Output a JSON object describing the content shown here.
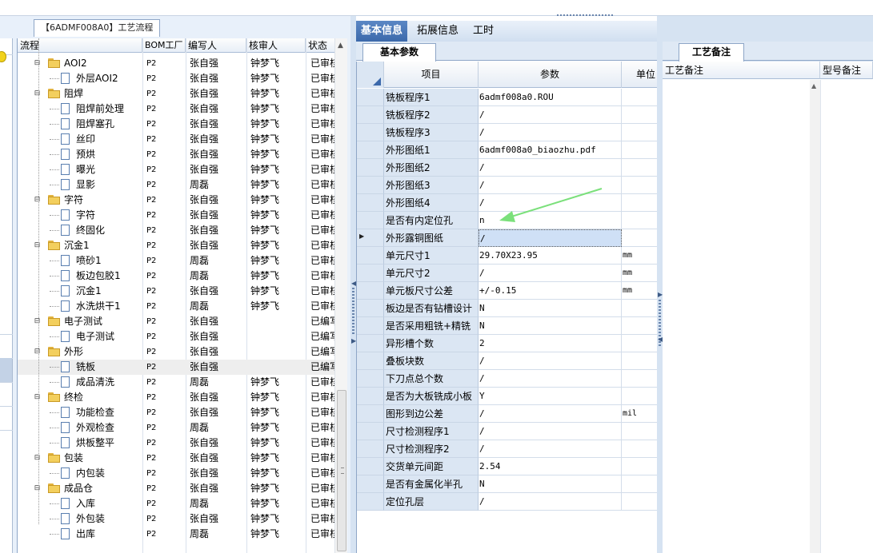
{
  "left": {
    "tab_title": "【6ADMF008A0】工艺流程",
    "columns": [
      "流程",
      "BOM工厂",
      "编写人",
      "核审人",
      "状态"
    ],
    "rows": [
      {
        "name": "AOI2",
        "level": 1,
        "type": "folder",
        "factory": "P2",
        "writer": "张自强",
        "reviewer": "钟梦飞",
        "status": "已审核"
      },
      {
        "name": "外层AOI2",
        "level": 2,
        "type": "doc",
        "factory": "P2",
        "writer": "张自强",
        "reviewer": "钟梦飞",
        "status": "已审核"
      },
      {
        "name": "阻焊",
        "level": 1,
        "type": "folder",
        "factory": "P2",
        "writer": "张自强",
        "reviewer": "钟梦飞",
        "status": "已审核"
      },
      {
        "name": "阻焊前处理",
        "level": 2,
        "type": "doc",
        "factory": "P2",
        "writer": "张自强",
        "reviewer": "钟梦飞",
        "status": "已审核"
      },
      {
        "name": "阻焊塞孔",
        "level": 2,
        "type": "doc",
        "factory": "P2",
        "writer": "张自强",
        "reviewer": "钟梦飞",
        "status": "已审核"
      },
      {
        "name": "丝印",
        "level": 2,
        "type": "doc",
        "factory": "P2",
        "writer": "张自强",
        "reviewer": "钟梦飞",
        "status": "已审核"
      },
      {
        "name": "预烘",
        "level": 2,
        "type": "doc",
        "factory": "P2",
        "writer": "张自强",
        "reviewer": "钟梦飞",
        "status": "已审核"
      },
      {
        "name": "曝光",
        "level": 2,
        "type": "doc",
        "factory": "P2",
        "writer": "张自强",
        "reviewer": "钟梦飞",
        "status": "已审核"
      },
      {
        "name": "显影",
        "level": 2,
        "type": "doc",
        "factory": "P2",
        "writer": "周磊",
        "reviewer": "钟梦飞",
        "status": "已审核"
      },
      {
        "name": "字符",
        "level": 1,
        "type": "folder",
        "factory": "P2",
        "writer": "张自强",
        "reviewer": "钟梦飞",
        "status": "已审核"
      },
      {
        "name": "字符",
        "level": 2,
        "type": "doc",
        "factory": "P2",
        "writer": "张自强",
        "reviewer": "钟梦飞",
        "status": "已审核"
      },
      {
        "name": "终固化",
        "level": 2,
        "type": "doc",
        "factory": "P2",
        "writer": "张自强",
        "reviewer": "钟梦飞",
        "status": "已审核"
      },
      {
        "name": "沉金1",
        "level": 1,
        "type": "folder",
        "factory": "P2",
        "writer": "张自强",
        "reviewer": "钟梦飞",
        "status": "已审核"
      },
      {
        "name": "喷砂1",
        "level": 2,
        "type": "doc",
        "factory": "P2",
        "writer": "周磊",
        "reviewer": "钟梦飞",
        "status": "已审核"
      },
      {
        "name": "板边包胶1",
        "level": 2,
        "type": "doc",
        "factory": "P2",
        "writer": "周磊",
        "reviewer": "钟梦飞",
        "status": "已审核"
      },
      {
        "name": "沉金1",
        "level": 2,
        "type": "doc",
        "factory": "P2",
        "writer": "张自强",
        "reviewer": "钟梦飞",
        "status": "已审核"
      },
      {
        "name": "水洗烘干1",
        "level": 2,
        "type": "doc",
        "factory": "P2",
        "writer": "周磊",
        "reviewer": "钟梦飞",
        "status": "已审核"
      },
      {
        "name": "电子测试",
        "level": 1,
        "type": "folder",
        "factory": "P2",
        "writer": "张自强",
        "reviewer": "",
        "status": "已编写"
      },
      {
        "name": "电子测试",
        "level": 2,
        "type": "doc",
        "factory": "P2",
        "writer": "张自强",
        "reviewer": "",
        "status": "已编写"
      },
      {
        "name": "外形",
        "level": 1,
        "type": "folder",
        "factory": "P2",
        "writer": "张自强",
        "reviewer": "",
        "status": "已编写"
      },
      {
        "name": "铣板",
        "level": 2,
        "type": "doc",
        "factory": "P2",
        "writer": "张自强",
        "reviewer": "",
        "status": "已编写",
        "selected": true
      },
      {
        "name": "成品清洗",
        "level": 2,
        "type": "doc",
        "factory": "P2",
        "writer": "周磊",
        "reviewer": "钟梦飞",
        "status": "已审核"
      },
      {
        "name": "终检",
        "level": 1,
        "type": "folder",
        "factory": "P2",
        "writer": "张自强",
        "reviewer": "钟梦飞",
        "status": "已审核"
      },
      {
        "name": "功能检查",
        "level": 2,
        "type": "doc",
        "factory": "P2",
        "writer": "张自强",
        "reviewer": "钟梦飞",
        "status": "已审核"
      },
      {
        "name": "外观检查",
        "level": 2,
        "type": "doc",
        "factory": "P2",
        "writer": "周磊",
        "reviewer": "钟梦飞",
        "status": "已审核"
      },
      {
        "name": "烘板整平",
        "level": 2,
        "type": "doc",
        "factory": "P2",
        "writer": "张自强",
        "reviewer": "钟梦飞",
        "status": "已审核"
      },
      {
        "name": "包装",
        "level": 1,
        "type": "folder",
        "factory": "P2",
        "writer": "张自强",
        "reviewer": "钟梦飞",
        "status": "已审核"
      },
      {
        "name": "内包装",
        "level": 2,
        "type": "doc",
        "factory": "P2",
        "writer": "张自强",
        "reviewer": "钟梦飞",
        "status": "已审核"
      },
      {
        "name": "成品仓",
        "level": 1,
        "type": "folder",
        "factory": "P2",
        "writer": "张自强",
        "reviewer": "钟梦飞",
        "status": "已审核"
      },
      {
        "name": "入库",
        "level": 2,
        "type": "doc",
        "factory": "P2",
        "writer": "周磊",
        "reviewer": "钟梦飞",
        "status": "已审核"
      },
      {
        "name": "外包装",
        "level": 2,
        "type": "doc",
        "factory": "P2",
        "writer": "张自强",
        "reviewer": "钟梦飞",
        "status": "已审核"
      },
      {
        "name": "出库",
        "level": 2,
        "type": "doc",
        "factory": "P2",
        "writer": "周磊",
        "reviewer": "钟梦飞",
        "status": "已审核"
      }
    ]
  },
  "middle": {
    "tabs": [
      "基本信息",
      "拓展信息",
      "工时"
    ],
    "active_tab": "基本信息",
    "subtab": "基本参数",
    "columns": [
      "项目",
      "参数",
      "单位"
    ],
    "rows": [
      {
        "item": "铣板程序1",
        "value": "6admf008a0.ROU",
        "unit": ""
      },
      {
        "item": "铣板程序2",
        "value": "/",
        "unit": ""
      },
      {
        "item": "铣板程序3",
        "value": "/",
        "unit": ""
      },
      {
        "item": "外形图纸1",
        "value": "6admf008a0_biaozhu.pdf",
        "unit": ""
      },
      {
        "item": "外形图纸2",
        "value": "/",
        "unit": ""
      },
      {
        "item": "外形图纸3",
        "value": "/",
        "unit": ""
      },
      {
        "item": "外形图纸4",
        "value": "/",
        "unit": ""
      },
      {
        "item": "是否有内定位孔",
        "value": "n",
        "unit": ""
      },
      {
        "item": "外形露铜图纸",
        "value": "/",
        "unit": "",
        "current": true
      },
      {
        "item": "单元尺寸1",
        "value": "29.70X23.95",
        "unit": "mm"
      },
      {
        "item": "单元尺寸2",
        "value": "/",
        "unit": "mm"
      },
      {
        "item": "单元板尺寸公差",
        "value": "+/-0.15",
        "unit": "mm"
      },
      {
        "item": "板边是否有钻槽设计",
        "value": "N",
        "unit": ""
      },
      {
        "item": "是否采用粗铣+精铣",
        "value": "N",
        "unit": ""
      },
      {
        "item": "异形槽个数",
        "value": "2",
        "unit": ""
      },
      {
        "item": "叠板块数",
        "value": "/",
        "unit": ""
      },
      {
        "item": "下刀点总个数",
        "value": "/",
        "unit": ""
      },
      {
        "item": "是否为大板铣成小板",
        "value": "Y",
        "unit": ""
      },
      {
        "item": "图形到边公差",
        "value": "/",
        "unit": "mil"
      },
      {
        "item": "尺寸检测程序1",
        "value": "/",
        "unit": ""
      },
      {
        "item": "尺寸检测程序2",
        "value": "/",
        "unit": ""
      },
      {
        "item": "交货单元间距",
        "value": "2.54",
        "unit": ""
      },
      {
        "item": "是否有金属化半孔",
        "value": "N",
        "unit": ""
      },
      {
        "item": "定位孔层",
        "value": "/",
        "unit": ""
      }
    ]
  },
  "right": {
    "subtab": "工艺备注",
    "columns": [
      "工艺备注",
      "型号备注"
    ]
  },
  "colors": {
    "active_tab": "#3c69ab",
    "selection": "#cfe0f6",
    "annotation_arrow": "#7be07b"
  }
}
